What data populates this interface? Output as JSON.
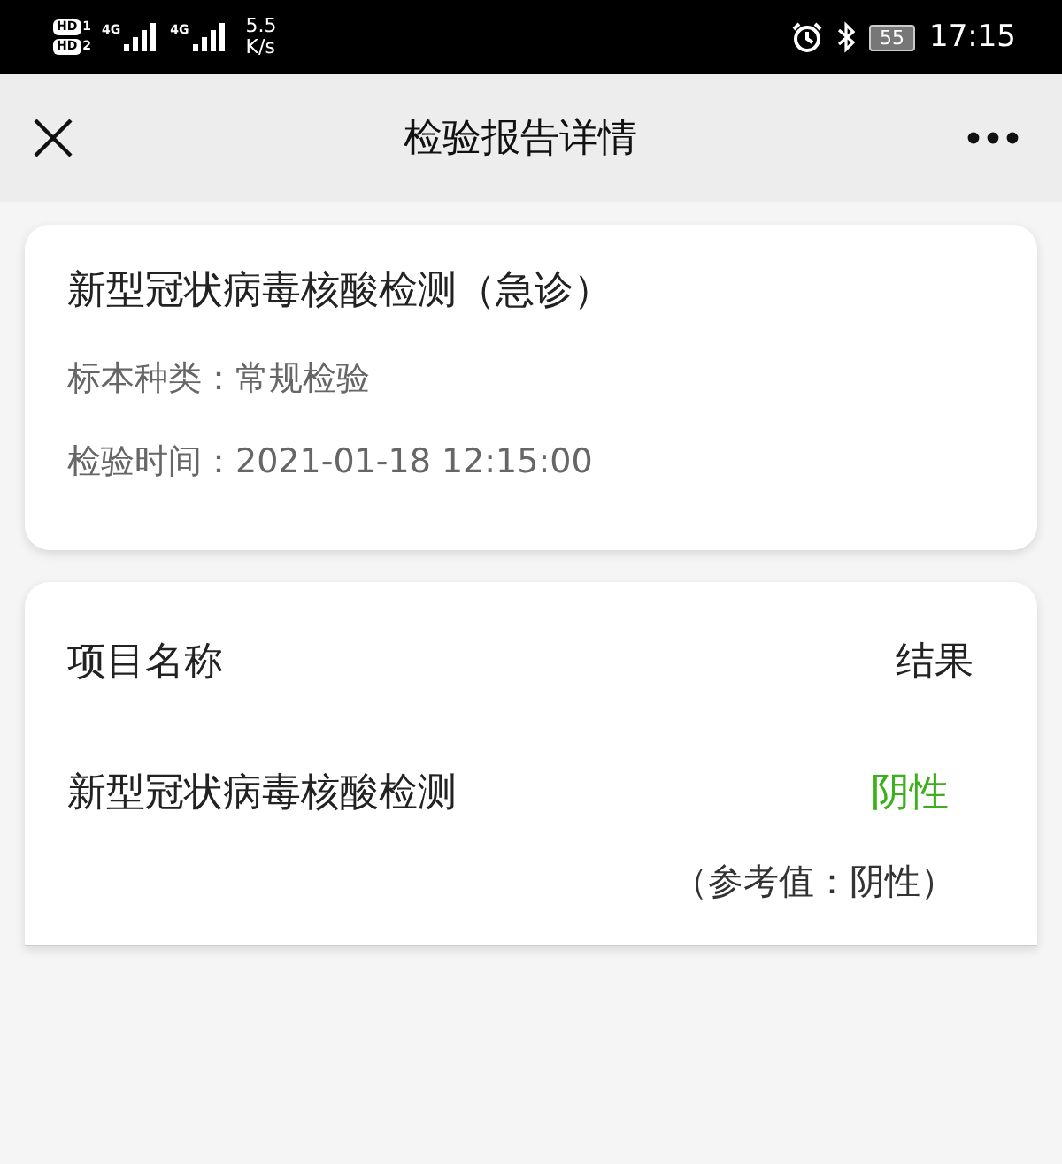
{
  "status_bar": {
    "sims": [
      {
        "hd": "HD",
        "network": "4G",
        "sim": "1"
      },
      {
        "hd": "HD",
        "network": "4G",
        "sim": "2"
      }
    ],
    "speed_value": "5.5",
    "speed_unit": "K/s",
    "battery": "55",
    "time": "17:15"
  },
  "nav": {
    "title": "检验报告详情"
  },
  "summary": {
    "title": "新型冠状病毒核酸检测（急诊）",
    "fields": [
      {
        "label": "标本种类：",
        "value": "常规检验"
      },
      {
        "label": "检验时间：",
        "value": "2021-01-18 12:15:00"
      }
    ]
  },
  "results": {
    "columns": [
      "项目名称",
      "结果"
    ],
    "rows": [
      {
        "name": "新型冠状病毒核酸检测",
        "result": "阴性",
        "abnormal": false,
        "reference": "（参考值：阴性）"
      }
    ]
  }
}
